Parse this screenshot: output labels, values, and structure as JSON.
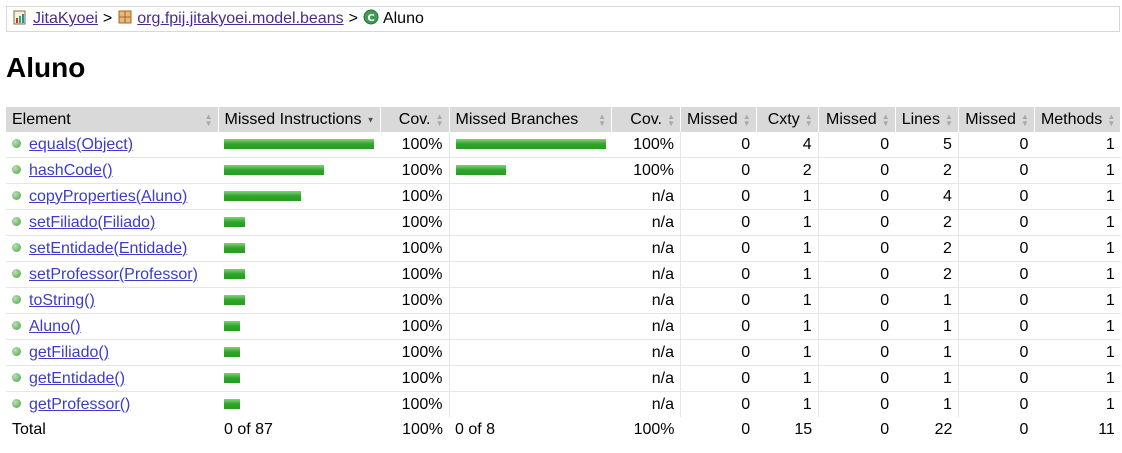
{
  "breadcrumb": {
    "items": [
      {
        "label": "JitaKyoei",
        "icon": "report-icon"
      },
      {
        "label": "org.fpij.jitakyoei.model.beans",
        "icon": "package-icon"
      },
      {
        "label": "Aluno",
        "icon": "class-icon"
      }
    ],
    "separator": ">"
  },
  "title": "Aluno",
  "table": {
    "headers": [
      "Element",
      "Missed Instructions",
      "Cov.",
      "Missed Branches",
      "Cov.",
      "Missed",
      "Cxty",
      "Missed",
      "Lines",
      "Missed",
      "Methods"
    ],
    "rows": [
      {
        "name": "equals(Object)",
        "instr_bar": 1.0,
        "instr_cov": "100%",
        "branch_bar": 1.0,
        "branch_cov": "100%",
        "missed_cxty": "0",
        "cxty": "4",
        "missed_lines": "0",
        "lines": "5",
        "missed_methods": "0",
        "methods": "1"
      },
      {
        "name": "hashCode()",
        "instr_bar": 0.667,
        "instr_cov": "100%",
        "branch_bar": 0.333,
        "branch_cov": "100%",
        "missed_cxty": "0",
        "cxty": "2",
        "missed_lines": "0",
        "lines": "2",
        "missed_methods": "0",
        "methods": "1"
      },
      {
        "name": "copyProperties(Aluno)",
        "instr_bar": 0.513,
        "instr_cov": "100%",
        "branch_bar": 0,
        "branch_cov": "n/a",
        "missed_cxty": "0",
        "cxty": "1",
        "missed_lines": "0",
        "lines": "4",
        "missed_methods": "0",
        "methods": "1"
      },
      {
        "name": "setFiliado(Filiado)",
        "instr_bar": 0.14,
        "instr_cov": "100%",
        "branch_bar": 0,
        "branch_cov": "n/a",
        "missed_cxty": "0",
        "cxty": "1",
        "missed_lines": "0",
        "lines": "2",
        "missed_methods": "0",
        "methods": "1"
      },
      {
        "name": "setEntidade(Entidade)",
        "instr_bar": 0.14,
        "instr_cov": "100%",
        "branch_bar": 0,
        "branch_cov": "n/a",
        "missed_cxty": "0",
        "cxty": "1",
        "missed_lines": "0",
        "lines": "2",
        "missed_methods": "0",
        "methods": "1"
      },
      {
        "name": "setProfessor(Professor)",
        "instr_bar": 0.14,
        "instr_cov": "100%",
        "branch_bar": 0,
        "branch_cov": "n/a",
        "missed_cxty": "0",
        "cxty": "1",
        "missed_lines": "0",
        "lines": "2",
        "missed_methods": "0",
        "methods": "1"
      },
      {
        "name": "toString()",
        "instr_bar": 0.14,
        "instr_cov": "100%",
        "branch_bar": 0,
        "branch_cov": "n/a",
        "missed_cxty": "0",
        "cxty": "1",
        "missed_lines": "0",
        "lines": "1",
        "missed_methods": "0",
        "methods": "1"
      },
      {
        "name": "Aluno()",
        "instr_bar": 0.107,
        "instr_cov": "100%",
        "branch_bar": 0,
        "branch_cov": "n/a",
        "missed_cxty": "0",
        "cxty": "1",
        "missed_lines": "0",
        "lines": "1",
        "missed_methods": "0",
        "methods": "1"
      },
      {
        "name": "getFiliado()",
        "instr_bar": 0.107,
        "instr_cov": "100%",
        "branch_bar": 0,
        "branch_cov": "n/a",
        "missed_cxty": "0",
        "cxty": "1",
        "missed_lines": "0",
        "lines": "1",
        "missed_methods": "0",
        "methods": "1"
      },
      {
        "name": "getEntidade()",
        "instr_bar": 0.107,
        "instr_cov": "100%",
        "branch_bar": 0,
        "branch_cov": "n/a",
        "missed_cxty": "0",
        "cxty": "1",
        "missed_lines": "0",
        "lines": "1",
        "missed_methods": "0",
        "methods": "1"
      },
      {
        "name": "getProfessor()",
        "instr_bar": 0.107,
        "instr_cov": "100%",
        "branch_bar": 0,
        "branch_cov": "n/a",
        "missed_cxty": "0",
        "cxty": "1",
        "missed_lines": "0",
        "lines": "1",
        "missed_methods": "0",
        "methods": "1"
      }
    ],
    "total": {
      "label": "Total",
      "instr": "0 of 87",
      "instr_cov": "100%",
      "branch": "0 of 8",
      "branch_cov": "100%",
      "missed_cxty": "0",
      "cxty": "15",
      "missed_lines": "0",
      "lines": "22",
      "missed_methods": "0",
      "methods": "11"
    }
  },
  "colors": {
    "bar_green": "#2fa52a",
    "header_bg": "#d9d9d9",
    "link": "#3c3cc8",
    "visited_link": "#4b2b8f"
  }
}
